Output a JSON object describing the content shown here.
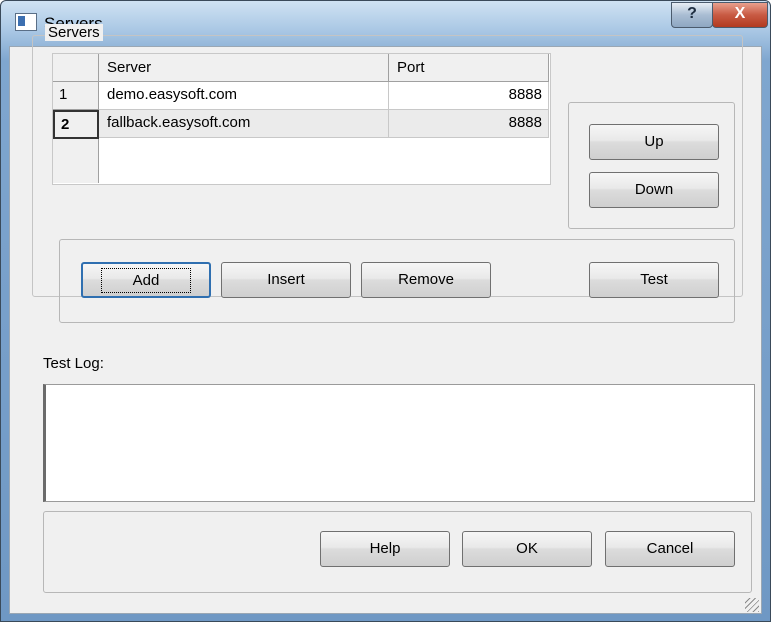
{
  "window": {
    "title": "Servers",
    "help_glyph": "?",
    "close_glyph": "X"
  },
  "servers_group": {
    "label": "Servers",
    "grid": {
      "columns": [
        "Server",
        "Port"
      ],
      "rows": [
        {
          "index": "1",
          "server": "demo.easysoft.com",
          "port": "8888",
          "selected": false
        },
        {
          "index": "2",
          "server": "fallback.easysoft.com",
          "port": "8888",
          "selected": true
        }
      ]
    },
    "buttons": {
      "up": "Up",
      "down": "Down",
      "add": "Add",
      "insert": "Insert",
      "remove": "Remove",
      "test": "Test"
    }
  },
  "test_log": {
    "label": "Test Log:",
    "value": ""
  },
  "footer": {
    "help": "Help",
    "ok": "OK",
    "cancel": "Cancel"
  }
}
